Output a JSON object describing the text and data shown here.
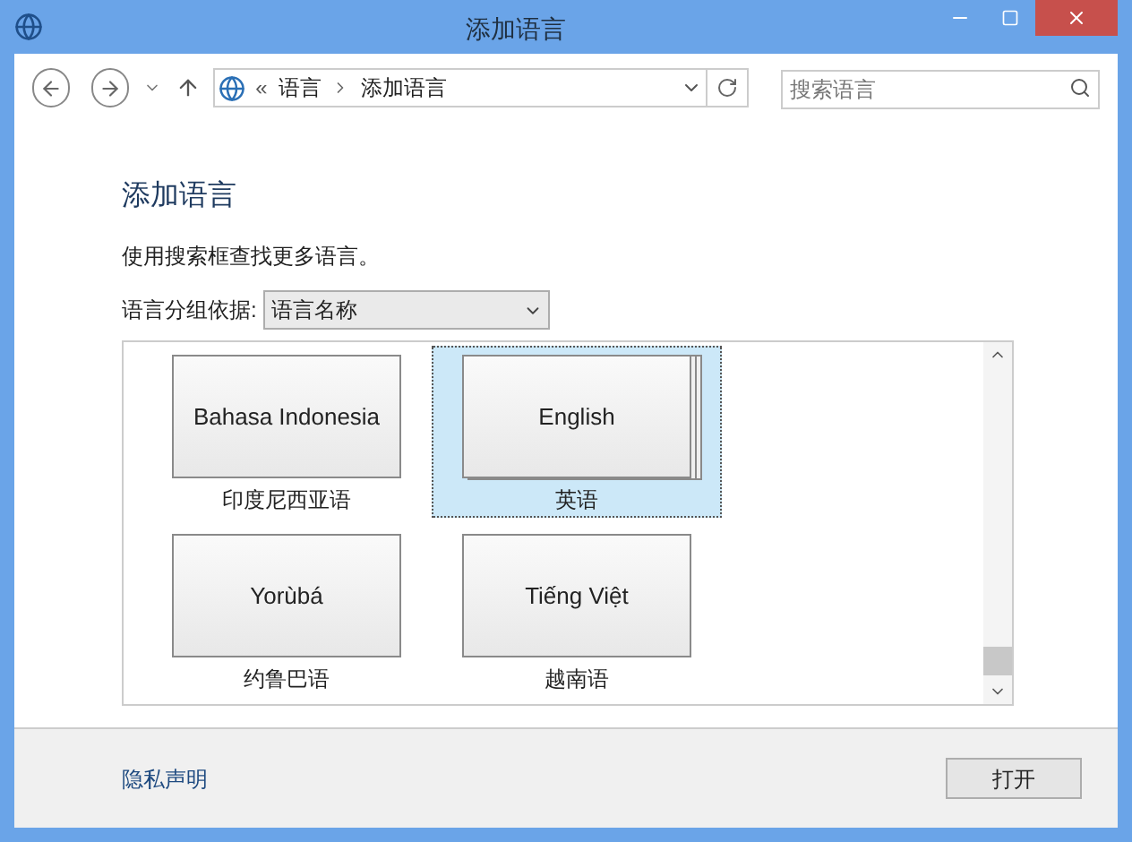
{
  "window": {
    "title": "添加语言"
  },
  "address_bar": {
    "path": [
      {
        "label": "语言"
      },
      {
        "label": "添加语言"
      }
    ],
    "overflow": "«"
  },
  "search": {
    "placeholder": "搜索语言"
  },
  "heading": "添加语言",
  "hint": "使用搜索框查找更多语言。",
  "group_by": {
    "label": "语言分组依据:",
    "value": "语言名称"
  },
  "languages": [
    {
      "native": "Bahasa Indonesia",
      "name": "印度尼西亚语",
      "selected": false,
      "stacked": false
    },
    {
      "native": "English",
      "name": "英语",
      "selected": true,
      "stacked": true
    },
    {
      "native": "Yorùbá",
      "name": "约鲁巴语",
      "selected": false,
      "stacked": false
    },
    {
      "native": "Tiếng Việt",
      "name": "越南语",
      "selected": false,
      "stacked": false
    }
  ],
  "footer": {
    "link": "隐私声明",
    "buttons": [
      "打开"
    ]
  }
}
